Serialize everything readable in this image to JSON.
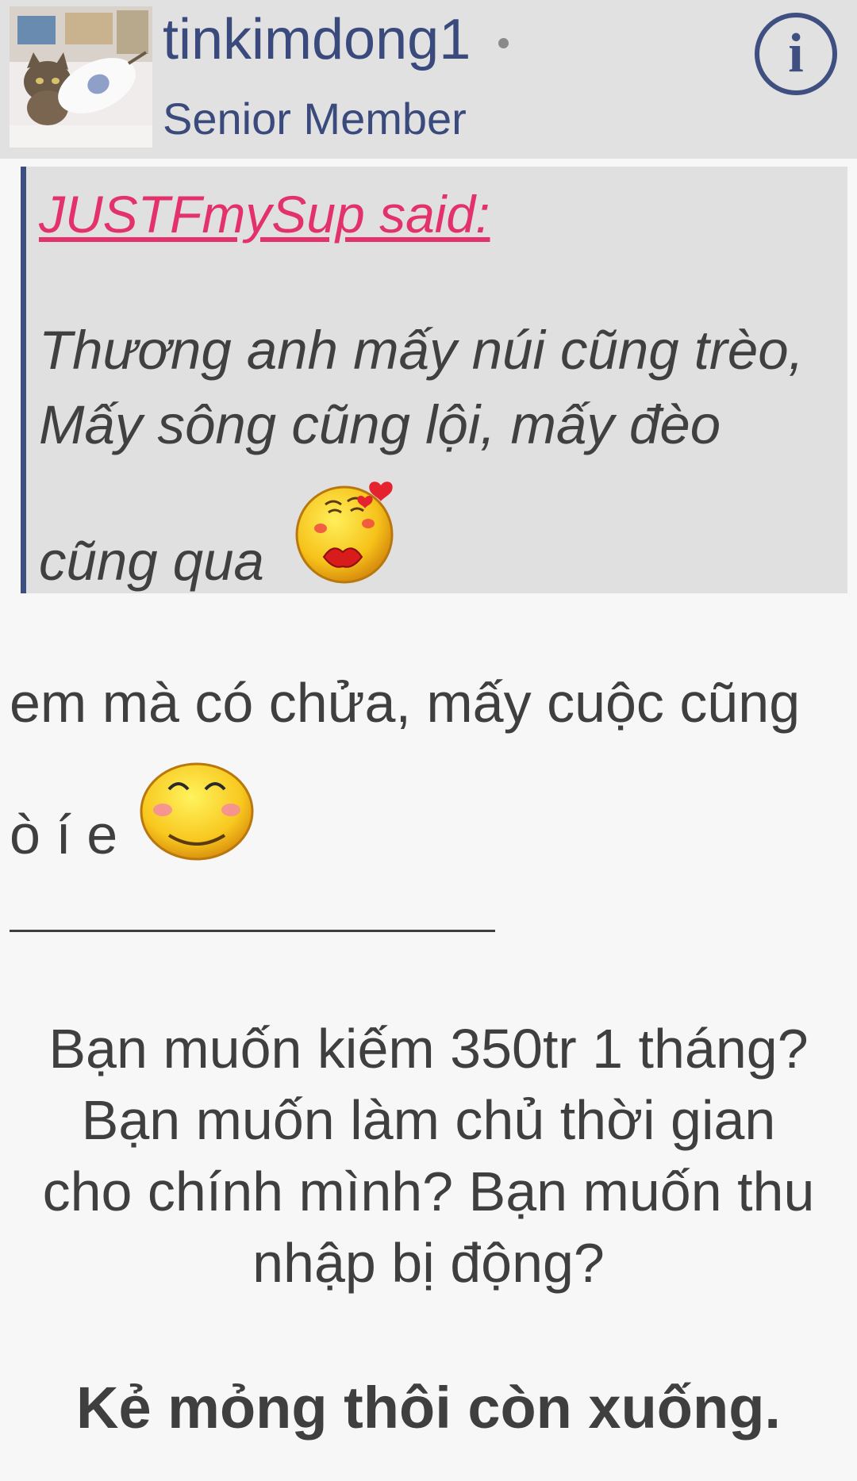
{
  "header": {
    "username": "tinkimdong1",
    "role": "Senior Member",
    "info_icon": "info-icon",
    "info_symbol": "i"
  },
  "quote": {
    "attribution": "JUSTFmySup said:",
    "lines": [
      "Thương anh mấy núi cũng trèo,",
      "Mấy sông cũng lội, mấy đèo",
      "cũng qua"
    ],
    "emoji": "kiss-emoji"
  },
  "reply": {
    "lines": [
      "em mà có chửa, mấy cuộc cũng",
      "ò í e"
    ],
    "emoji": "blushing-smile-emoji"
  },
  "signature": {
    "lines": [
      "Bạn muốn kiếm 350tr 1 tháng?",
      "Bạn muốn làm chủ thời gian",
      "cho chính mình? Bạn muốn thu",
      "nhập bị động?"
    ],
    "bold": "Kẻ mỏng thôi còn xuống."
  },
  "colors": {
    "header_bg": "#e1e1e1",
    "username": "#3a4a7c",
    "quote_link": "#e3326b",
    "quote_border": "#3d4e82",
    "text": "#3f3f3f"
  }
}
